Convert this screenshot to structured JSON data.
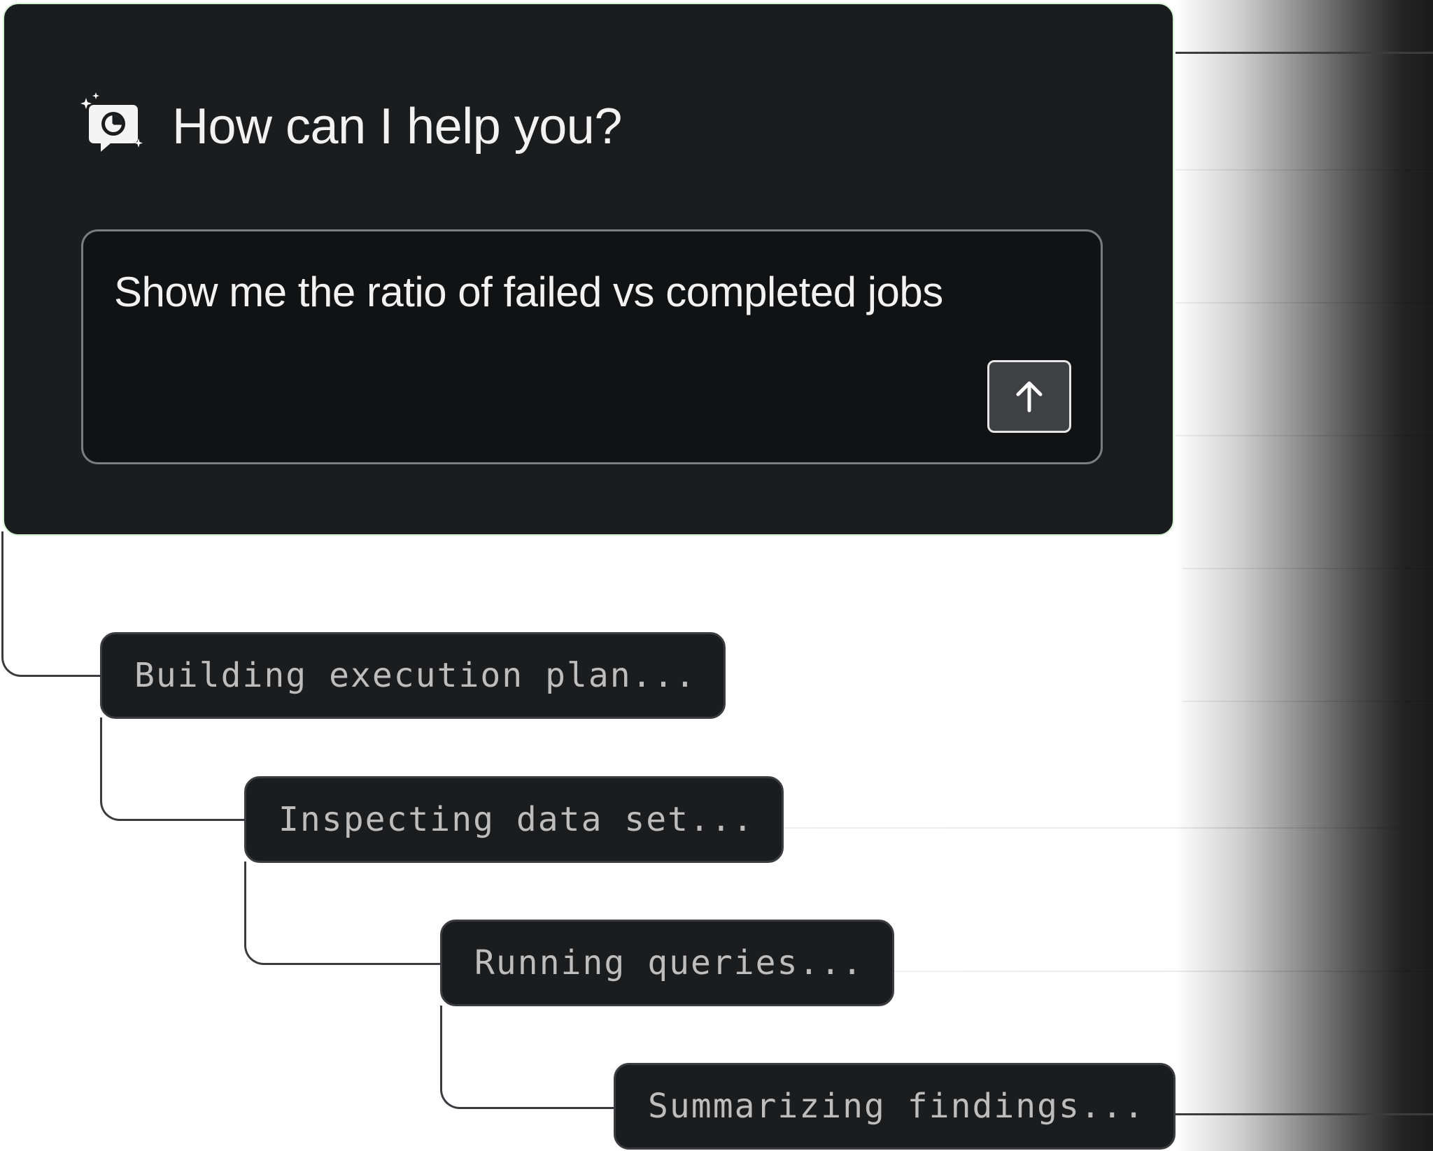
{
  "assistant": {
    "greeting": "How can I help you?",
    "icon": "chat-pie-chart-sparkle-icon"
  },
  "prompt": {
    "value": "Show me the ratio of failed vs completed jobs",
    "send_icon": "arrow-up-icon"
  },
  "steps": [
    {
      "label": "Building execution plan..."
    },
    {
      "label": "Inspecting data set..."
    },
    {
      "label": "Running queries..."
    },
    {
      "label": "Summarizing findings..."
    }
  ],
  "colors": {
    "card_background": "#1b1c1e",
    "input_background": "#111214",
    "card_border": "#d5efd2",
    "step_text": "#bdbdbd",
    "connector": "#3a3c40"
  }
}
